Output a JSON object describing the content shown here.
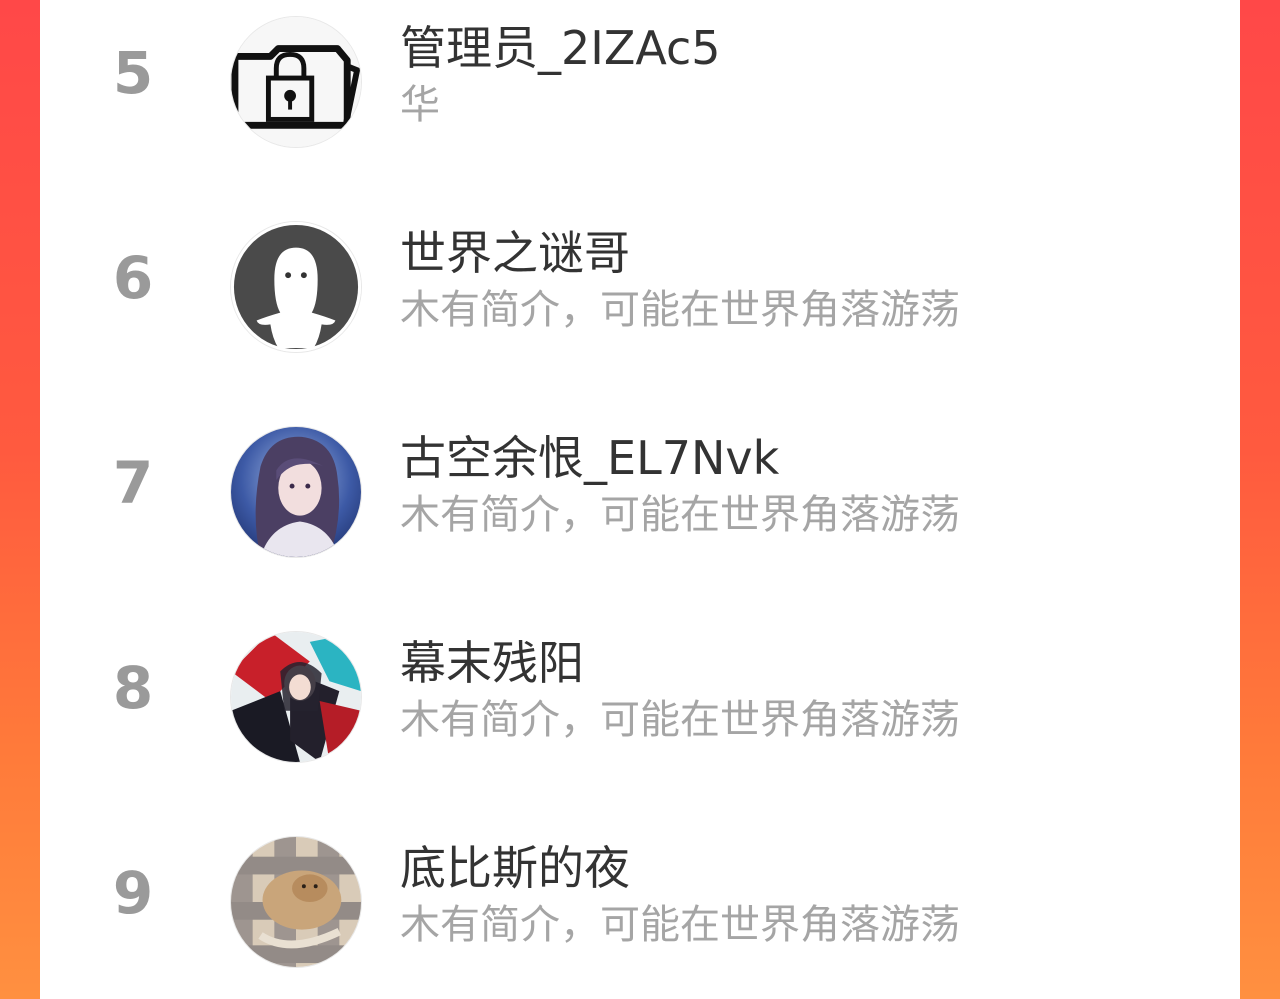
{
  "ranking_list": {
    "items": [
      {
        "rank": "5",
        "name": "管理员_2IZAc5",
        "description": "华",
        "avatar_icon": "locked-folder-icon"
      },
      {
        "rank": "6",
        "name": "世界之谜哥",
        "description": "木有简介，可能在世界角落游荡",
        "avatar_icon": "default-user-icon"
      },
      {
        "rank": "7",
        "name": "古空余恨_EL7Nvk",
        "description": "木有简介，可能在世界角落游荡",
        "avatar_icon": "user-photo"
      },
      {
        "rank": "8",
        "name": "幕末残阳",
        "description": "木有简介，可能在世界角落游荡",
        "avatar_icon": "user-photo"
      },
      {
        "rank": "9",
        "name": "底比斯的夜",
        "description": "木有简介，可能在世界角落游荡",
        "avatar_icon": "user-photo"
      }
    ]
  },
  "colors": {
    "background_gradient_start": "#ff4848",
    "background_gradient_end": "#ff9040",
    "rank_color": "#9a9a9a",
    "name_color": "#333333",
    "description_color": "#a5a5a5"
  }
}
